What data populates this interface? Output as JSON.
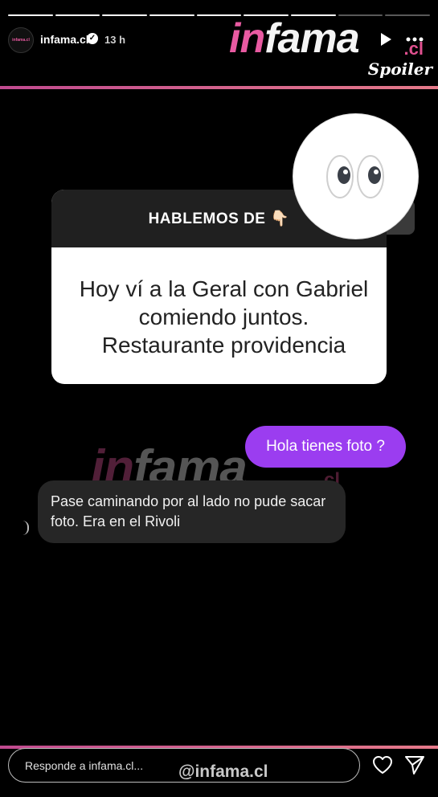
{
  "story": {
    "segments_total": 9,
    "segments_done": 7
  },
  "header": {
    "avatar_text": "infama.cl",
    "username": "infama.cl",
    "verified_mark": "✓",
    "timestamp": "13 h",
    "play_icon": "play-icon",
    "more_icon": "more-options-icon"
  },
  "logo": {
    "part_pink": "in",
    "part_white": "fama",
    "suffix": ".cl",
    "tagline": "Spoiler"
  },
  "question_card": {
    "title": "HABLEMOS DE 👇🏻",
    "answer": "Hoy ví a la Geral con Gabriel comiendo juntos. Restaurante providencia",
    "sticker": "👀"
  },
  "chat": {
    "outgoing": "Hola tienes foto ?",
    "incoming": "Pase caminando por al lado no pude sacar foto. Era en el Rivoli"
  },
  "watermark": {
    "part_pink": "in",
    "part_white": "fama",
    "suffix": ".cl"
  },
  "footer": {
    "reply_placeholder": "Responde a infama.cl...",
    "handle": "@infama.cl",
    "like_icon": "heart-icon",
    "share_icon": "send-icon"
  },
  "colors": {
    "accent_pink": "#e85aa1",
    "bubble_purple": "#9b3df0",
    "bubble_gray": "#262626"
  }
}
